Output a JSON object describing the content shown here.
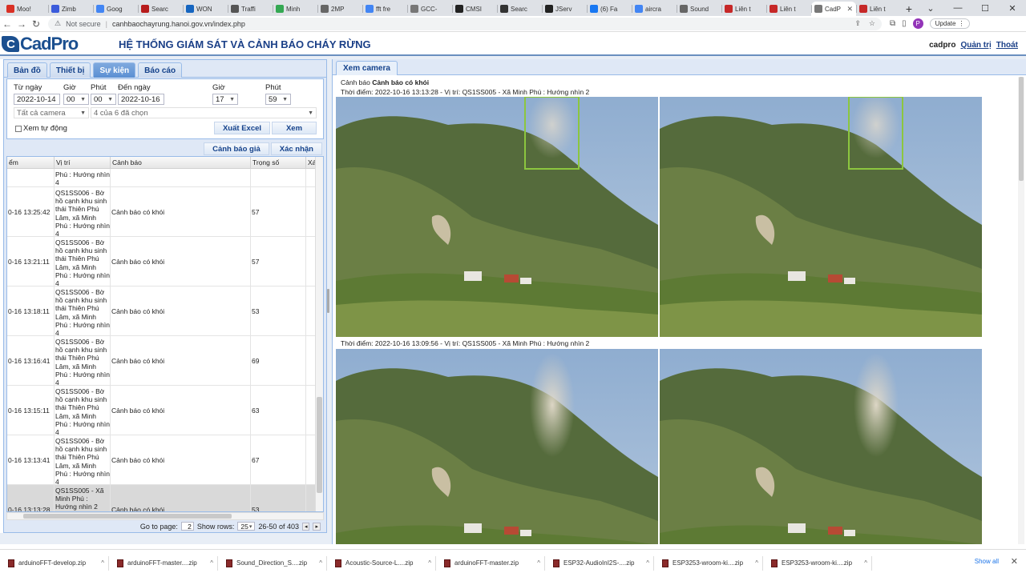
{
  "browser": {
    "tabs": [
      {
        "label": "Moo!",
        "color": "#d93025"
      },
      {
        "label": "Zimb",
        "color": "#3b5bdb"
      },
      {
        "label": "Goog",
        "color": "#4285f4"
      },
      {
        "label": "Searc",
        "color": "#b71c1c"
      },
      {
        "label": "WON",
        "color": "#1565c0"
      },
      {
        "label": "Traffi",
        "color": "#555555"
      },
      {
        "label": "Minh",
        "color": "#34a853"
      },
      {
        "label": "2MP",
        "color": "#666666"
      },
      {
        "label": "fft fre",
        "color": "#4285f4"
      },
      {
        "label": "GCC-",
        "color": "#777777"
      },
      {
        "label": "CMSI",
        "color": "#222222"
      },
      {
        "label": "Searc",
        "color": "#333333"
      },
      {
        "label": "JServ",
        "color": "#222222"
      },
      {
        "label": "(6) Fa",
        "color": "#1877f2"
      },
      {
        "label": "aircra",
        "color": "#4285f4"
      },
      {
        "label": "Sound",
        "color": "#666666"
      },
      {
        "label": "Liên t",
        "color": "#c62828"
      },
      {
        "label": "Liên t",
        "color": "#c62828"
      },
      {
        "label": "CadP",
        "color": "#777777",
        "active": true
      },
      {
        "label": "Liên t",
        "color": "#c62828"
      }
    ],
    "security_label": "Not secure",
    "url": "canhbaochayrung.hanoi.gov.vn/index.php",
    "profile_initial": "P",
    "update_label": "Update"
  },
  "app": {
    "logo_text": "CadPro",
    "logo_mark": "C",
    "title": "HỆ THỐNG GIÁM SÁT VÀ CẢNH BÁO CHÁY RỪNG",
    "username": "cadpro",
    "admin_link": "Quản trị",
    "logout_link": "Thoát"
  },
  "left_tabs": [
    {
      "label": "Bản đồ",
      "active": false
    },
    {
      "label": "Thiết bị",
      "active": false
    },
    {
      "label": "Sự kiện",
      "active": true
    },
    {
      "label": "Báo cáo",
      "active": false
    }
  ],
  "filter": {
    "from_date_label": "Từ ngày",
    "from_date": "2022-10-14",
    "hour_label": "Giờ",
    "from_hour": "00",
    "minute_label": "Phút",
    "from_minute": "00",
    "to_date_label": "Đến ngày",
    "to_date": "2022-10-16",
    "to_hour_label": "Giờ",
    "to_hour": "17",
    "to_minute_label": "Phút",
    "to_minute": "59",
    "camera_select": "Tất cả camera",
    "type_select": "4 của 6 đã chọn",
    "auto_view_label": "Xem tự động",
    "export_label": "Xuất Excel",
    "view_label": "Xem"
  },
  "actions": {
    "false_alarm": "Cảnh báo giả",
    "confirm": "Xác nhận"
  },
  "grid": {
    "columns": [
      "ểm",
      "Vị trí",
      "Cảnh báo",
      "Trọng số",
      "Xá"
    ],
    "rows": [
      {
        "time": "",
        "location": "Phú : Hướng nhìn 4",
        "warning": "",
        "weight": "",
        "partial": true
      },
      {
        "time": "0-16 13:25:42",
        "location": "QS1SS006 - Bờ hồ cạnh khu sinh thái Thiên Phú Lâm, xã Minh Phú : Hướng nhìn 4",
        "warning": "Cảnh báo có khói",
        "weight": "57"
      },
      {
        "time": "0-16 13:21:11",
        "location": "QS1SS006 - Bờ hồ cạnh khu sinh thái Thiên Phú Lâm, xã Minh Phú : Hướng nhìn 4",
        "warning": "Cảnh báo có khói",
        "weight": "57"
      },
      {
        "time": "0-16 13:18:11",
        "location": "QS1SS006 - Bờ hồ cạnh khu sinh thái Thiên Phú Lâm, xã Minh Phú : Hướng nhìn 4",
        "warning": "Cảnh báo có khói",
        "weight": "53"
      },
      {
        "time": "0-16 13:16:41",
        "location": "QS1SS006 - Bờ hồ cạnh khu sinh thái Thiên Phú Lâm, xã Minh Phú : Hướng nhìn 4",
        "warning": "Cảnh báo có khói",
        "weight": "69"
      },
      {
        "time": "0-16 13:15:11",
        "location": "QS1SS006 - Bờ hồ cạnh khu sinh thái Thiên Phú Lâm, xã Minh Phú : Hướng nhìn 4",
        "warning": "Cảnh báo có khói",
        "weight": "63"
      },
      {
        "time": "0-16 13:13:41",
        "location": "QS1SS006 - Bờ hồ cạnh khu sinh thái Thiên Phú Lâm, xã Minh Phú : Hướng nhìn 4",
        "warning": "Cảnh báo có khói",
        "weight": "67"
      },
      {
        "time": "0-16 13:13:28",
        "location": "QS1SS005 - Xã Minh Phú : Hướng nhìn 2",
        "warning": "Cảnh báo có khói",
        "weight": "53",
        "selected": true
      }
    ]
  },
  "pager": {
    "goto_label": "Go to page:",
    "page": "2",
    "show_rows_label": "Show rows:",
    "rows_per_page": "25",
    "range": "26-50 of 403"
  },
  "camera": {
    "tab_label": "Xem camera",
    "warning_prefix": "Cảnh báo",
    "warning_type": "Cảnh báo có khói",
    "event1": "Thời điểm: 2022-10-16 13:13:28 - Vị trí: QS1SS005 - Xã Minh Phú : Hướng nhìn 2",
    "event2": "Thời điểm: 2022-10-16 13:09:56 - Vị trí: QS1SS005 - Xã Minh Phú : Hướng nhìn 2"
  },
  "downloads": {
    "items": [
      "arduinoFFT-develop.zip",
      "arduinoFFT-master....zip",
      "Sound_Direction_S....zip",
      "Acoustic-Source-L....zip",
      "arduinoFFT-master.zip",
      "ESP32-AudioInI2S-....zip",
      "ESP3253-wroom-ki....zip",
      "ESP3253-wroom-ki....zip"
    ],
    "show_all": "Show all"
  },
  "colors": {
    "brand": "#1b4f8f",
    "panel_border": "#99bbe8",
    "detection_box": "#8cc63f"
  }
}
